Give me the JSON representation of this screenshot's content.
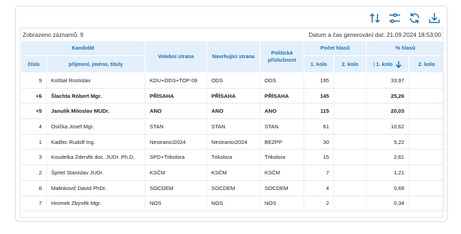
{
  "toolbar": {
    "icons": [
      "sort-icon",
      "filter-icon",
      "refresh-icon",
      "download-icon"
    ]
  },
  "meta": {
    "records_label": "Zobrazeno záznamů: 9",
    "generated_label": "Datum a čas generování dat: 21.09.2024 18:53:00"
  },
  "table": {
    "headers": {
      "kandidat": "Kandidát",
      "cislo": "číslo",
      "jmeno": "příjmení, jméno, tituly",
      "volebni_strana": "Volební strana",
      "navrhujici_strana": "Navrhující strana",
      "prislusnost": "Politická příslušnost",
      "pocet_hlasu": "Počet hlasů",
      "procent_hlasu": "% hlasů",
      "kolo1": "1. kolo",
      "kolo2": "2. kolo",
      "kolo1_pct": "1. kolo",
      "kolo2_pct": "2. kolo"
    },
    "rows": [
      {
        "cislo": "9",
        "jmeno": "Koštial Rostislav",
        "volebni": "KDU+ODS+TOP 09",
        "navrh": "ODS",
        "prisl": "ODS",
        "h1": "195",
        "h2": "",
        "p1": "33,97",
        "p2": "",
        "bold": false
      },
      {
        "cislo": "+6",
        "jmeno": "Šlachta Róbert Mgr.",
        "volebni": "PŘÍSAHA",
        "navrh": "PŘÍSAHA",
        "prisl": "PŘÍSAHA",
        "h1": "145",
        "h2": "",
        "p1": "25,26",
        "p2": "",
        "bold": true
      },
      {
        "cislo": "+5",
        "jmeno": "Janulík Miloslav MUDr.",
        "volebni": "ANO",
        "navrh": "ANO",
        "prisl": "ANO",
        "h1": "115",
        "h2": "",
        "p1": "20,03",
        "p2": "",
        "bold": true
      },
      {
        "cislo": "4",
        "jmeno": "Osička Josef Mgr.",
        "volebni": "STAN",
        "navrh": "STAN",
        "prisl": "STAN",
        "h1": "61",
        "h2": "",
        "p1": "10,62",
        "p2": "",
        "bold": false
      },
      {
        "cislo": "1",
        "jmeno": "Kadlec Rudolf Ing.",
        "volebni": "Nestranici2024",
        "navrh": "Nestranici2024",
        "prisl": "BEZPP",
        "h1": "30",
        "h2": "",
        "p1": "5,22",
        "p2": "",
        "bold": false
      },
      {
        "cislo": "3",
        "jmeno": "Koudelka Zdeněk doc. JUDr. Ph.D.",
        "volebni": "SPD+Trikolora",
        "navrh": "Trikolora",
        "prisl": "Trikolora",
        "h1": "15",
        "h2": "",
        "p1": "2,61",
        "p2": "",
        "bold": false
      },
      {
        "cislo": "2",
        "jmeno": "Šprtel Stanislav JUDr.",
        "volebni": "KSČM",
        "navrh": "KSČM",
        "prisl": "KSČM",
        "h1": "7",
        "h2": "",
        "p1": "1,21",
        "p2": "",
        "bold": false
      },
      {
        "cislo": "8",
        "jmeno": "Malinkovič David PhDr.",
        "volebni": "SOCDEM",
        "navrh": "SOCDEM",
        "prisl": "SOCDEM",
        "h1": "4",
        "h2": "",
        "p1": "0,69",
        "p2": "",
        "bold": false
      },
      {
        "cislo": "7",
        "jmeno": "Hromek Zbyněk Mgr.",
        "volebni": "NOS",
        "navrh": "NOS",
        "prisl": "NOS",
        "h1": "2",
        "h2": "",
        "p1": "0,34",
        "p2": "",
        "bold": false
      }
    ]
  },
  "colors": {
    "accent": "#1f6fb2",
    "header_bg": "#e3f0fb"
  }
}
